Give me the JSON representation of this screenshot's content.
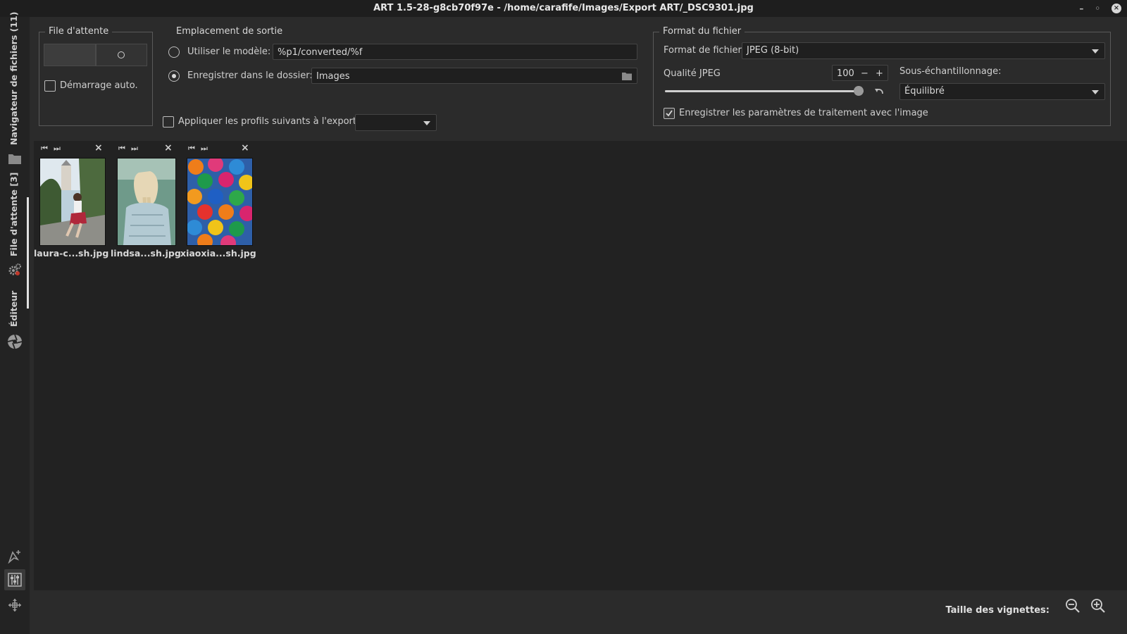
{
  "window": {
    "title": "ART 1.5-28-g8cb70f97e - /home/carafife/Images/Export ART/_DSC9301.jpg",
    "minimize": "–",
    "restore": "◦",
    "close": "×"
  },
  "sidebar": {
    "tabs": [
      {
        "label": "Navigateur de fichiers (11)",
        "icon": "folder-icon"
      },
      {
        "label": "File d'attente [3]",
        "icon": "gears-icon"
      },
      {
        "label": "Éditeur",
        "icon": "aperture-icon"
      }
    ],
    "bottom_icons": [
      "cursor-add-icon",
      "sliders-icon",
      "move-icon"
    ]
  },
  "queue_group": {
    "legend": "File d'attente",
    "auto_start_label": "Démarrage auto.",
    "auto_start_checked": false
  },
  "output_location": {
    "legend": "Emplacement de sortie",
    "use_template_label": "Utiliser le modèle:",
    "template_value": "%p1/converted/%f",
    "save_in_folder_label": "Enregistrer dans le dossier:",
    "folder_value": "Images",
    "selected": "save_in_folder",
    "apply_profiles_label": "Appliquer les profils suivants à l'export:",
    "apply_profiles_checked": false,
    "profiles_value": ""
  },
  "file_format": {
    "legend": "Format du fichier",
    "format_label": "Format de fichier:",
    "format_value": "JPEG (8-bit)",
    "quality_label": "Qualité JPEG",
    "quality_value": "100",
    "quality_fraction": 1.0,
    "subsampling_label": "Sous-échantillonnage:",
    "subsampling_value": "Équilibré",
    "save_params_label": "Enregistrer les paramètres de traitement avec l'image",
    "save_params_checked": true
  },
  "queue_items": [
    {
      "name": "laura-c...sh.jpg",
      "icon": "photo-thumbnail"
    },
    {
      "name": "lindsa...sh.jpg",
      "icon": "photo-thumbnail"
    },
    {
      "name": "xiaoxia...sh.jpg",
      "icon": "photo-thumbnail"
    }
  ],
  "status": {
    "thumb_size_label": "Taille des vignettes:",
    "zoom_out_icon": "zoom-out-icon",
    "zoom_in_icon": "zoom-in-icon"
  },
  "colors": {
    "background": "#2b2b2b",
    "panel": "#222222",
    "accent": "#d8d8d8"
  }
}
